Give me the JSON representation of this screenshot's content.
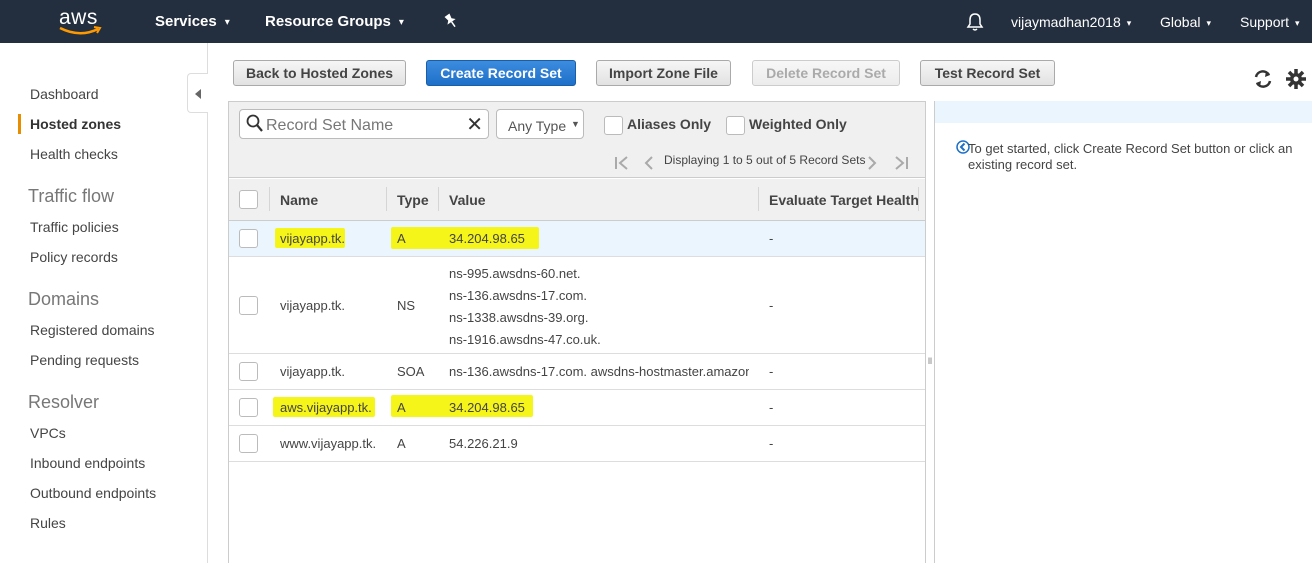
{
  "brand": {
    "logo_text": "aws"
  },
  "topnav": {
    "services": "Services",
    "resource_groups": "Resource Groups",
    "user": "vijaymadhan2018",
    "region": "Global",
    "support": "Support"
  },
  "sidebar": {
    "items": [
      {
        "label": "Dashboard"
      },
      {
        "label": "Hosted zones",
        "active": true
      },
      {
        "label": "Health checks"
      }
    ],
    "sections": [
      {
        "title": "Traffic flow",
        "items": [
          "Traffic policies",
          "Policy records"
        ]
      },
      {
        "title": "Domains",
        "items": [
          "Registered domains",
          "Pending requests"
        ]
      },
      {
        "title": "Resolver",
        "items": [
          "VPCs",
          "Inbound endpoints",
          "Outbound endpoints",
          "Rules"
        ]
      }
    ]
  },
  "toolbar": {
    "back": "Back to Hosted Zones",
    "create": "Create Record Set",
    "import": "Import Zone File",
    "delete": "Delete Record Set",
    "test": "Test Record Set"
  },
  "filters": {
    "search_placeholder": "Record Set Name",
    "type_select": "Any Type",
    "aliases_only": "Aliases Only",
    "weighted_only": "Weighted Only",
    "pager_text": "Displaying 1 to 5 out of 5 Record Sets"
  },
  "table": {
    "columns": [
      "Name",
      "Type",
      "Value",
      "Evaluate Target Health"
    ],
    "rows": [
      {
        "name": "vijayapp.tk.",
        "type": "A",
        "value": [
          "34.204.98.65"
        ],
        "eval": "-",
        "highlight": true,
        "selected": true
      },
      {
        "name": "vijayapp.tk.",
        "type": "NS",
        "value": [
          "ns-995.awsdns-60.net.",
          "ns-136.awsdns-17.com.",
          "ns-1338.awsdns-39.org.",
          "ns-1916.awsdns-47.co.uk."
        ],
        "eval": "-"
      },
      {
        "name": "vijayapp.tk.",
        "type": "SOA",
        "value": [
          "ns-136.awsdns-17.com. awsdns-hostmaster.amazon"
        ],
        "eval": "-"
      },
      {
        "name": "aws.vijayapp.tk.",
        "type": "A",
        "value": [
          "34.204.98.65"
        ],
        "eval": "-",
        "highlight": true
      },
      {
        "name": "www.vijayapp.tk.",
        "type": "A",
        "value": [
          "54.226.21.9"
        ],
        "eval": "-"
      }
    ]
  },
  "right_panel": {
    "message": "To get started, click Create Record Set button or click an existing record set."
  },
  "colors": {
    "nav_bg": "#232f3e",
    "primary": "#1e6fc8",
    "active_accent": "#e88d00",
    "highlight": "#f6f51a"
  }
}
